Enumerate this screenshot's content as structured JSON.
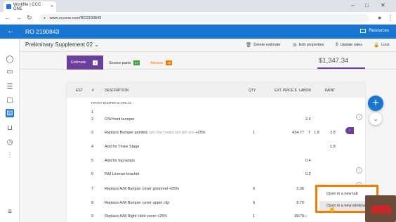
{
  "browser": {
    "tab_title": "Workfile | CCC ONE",
    "url": "www.cccone.com/RO2190843"
  },
  "app": {
    "ro_title": "RO 2190843",
    "resources_label": "Resources"
  },
  "estimate": {
    "title": "Preliminary Supplement 02",
    "toolbar": {
      "delete": "Delete estimate",
      "edit": "Edit properties",
      "update": "Update rates",
      "lock": "Lock"
    },
    "tabs": {
      "estimate": "Estimate",
      "estimate_count": "3",
      "source_parts": "Source parts",
      "source_count": "17",
      "advisor": "Advisor",
      "advisor_count": "10"
    },
    "total": "$1,347.34"
  },
  "table": {
    "headers": {
      "est": "EST",
      "num": "#",
      "description": "DESCRIPTION",
      "qty": "QTY",
      "ext_price": "EXT. PRICE $",
      "labor": "LABOR",
      "paint": "PAINT"
    },
    "section": "FRONT BUMPER & GRILLE",
    "rows": [
      {
        "num": "1",
        "desc": "",
        "qty": "",
        "price": "",
        "t": "",
        "labor": "",
        "paint": ""
      },
      {
        "num": "2",
        "desc": "O/H front bumper",
        "qty": "",
        "price": "",
        "t": "",
        "labor": "2.4",
        "paint": ""
      },
      {
        "num": "3",
        "desc": "Replace Bumper painted, ",
        "desc_muted": "w/o tow hooks w/o prk sns",
        "desc_tail": " +25%",
        "qty": "1",
        "price": "434.77",
        "t": "T",
        "labor": "1.8",
        "paint": "2.8"
      },
      {
        "num": "4",
        "desc": "Add for Three Stage",
        "qty": "",
        "price": "",
        "t": "",
        "labor": "",
        "paint": "1.8"
      },
      {
        "num": "5",
        "desc": "Add for fog lamps",
        "qty": "",
        "price": "",
        "t": "",
        "labor": "0.4",
        "paint": ""
      },
      {
        "num": "6",
        "desc": "R&I License bracket",
        "qty": "",
        "price": "",
        "t": "",
        "labor": "0.2",
        "paint": ""
      },
      {
        "num": "7",
        "desc": "Replace A/M Bumper cover grommet +25%",
        "qty": "6",
        "price": "3.36",
        "t": "",
        "labor": "",
        "paint": ""
      },
      {
        "num": "8",
        "desc": "Replace A/M Bumper cover upper clip",
        "qty": "6",
        "price": "8.70",
        "t": "",
        "labor": "",
        "paint": ""
      },
      {
        "num": "9",
        "desc": "Replace A/M Right Hold cover +25%",
        "qty": "1",
        "price": "38.70",
        "t": "",
        "incl": "m  Incl",
        "labor": "",
        "paint": ""
      }
    ]
  },
  "context_menu": {
    "item1": "Open in a new tab",
    "item2": "Open in a new window"
  },
  "colors": {
    "brand_blue": "#1976d2",
    "estimate_purple": "#6a3fa0",
    "source_green": "#43a047",
    "advisor_orange": "#f57c00",
    "highlight_border": "#f57c00"
  }
}
